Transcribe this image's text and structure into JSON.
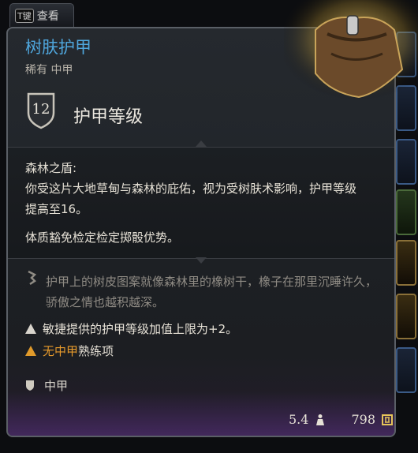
{
  "tab": {
    "key": "T键",
    "label": "查看"
  },
  "item": {
    "name": "树肤护甲",
    "rarity_type": "稀有 中甲",
    "armor_class": "12",
    "armor_class_label": "护甲等级"
  },
  "passive": {
    "name": "森林之盾:",
    "description": "你受这片大地草甸与森林的庇佑，视为受树肤术影响，护甲等级提高至16。",
    "extra": "体质豁免检定检定掷骰优势。"
  },
  "lore": "护甲上的树皮图案就像森林里的橡树干，橡子在那里沉睡许久，骄傲之情也越积越深。",
  "warnings": [
    {
      "text": "敏捷提供的护甲等级加值上限为+2。",
      "color": "#d8d4cc"
    },
    {
      "highlight": "无中甲",
      "rest": "熟练项",
      "color": "#e09a2a"
    }
  ],
  "armor_type": "中甲",
  "footer": {
    "weight": "5.4",
    "value": "798"
  },
  "colors": {
    "title": "#4fa7de",
    "warning": "#e09a2a",
    "panel_bg": "#22262b"
  }
}
